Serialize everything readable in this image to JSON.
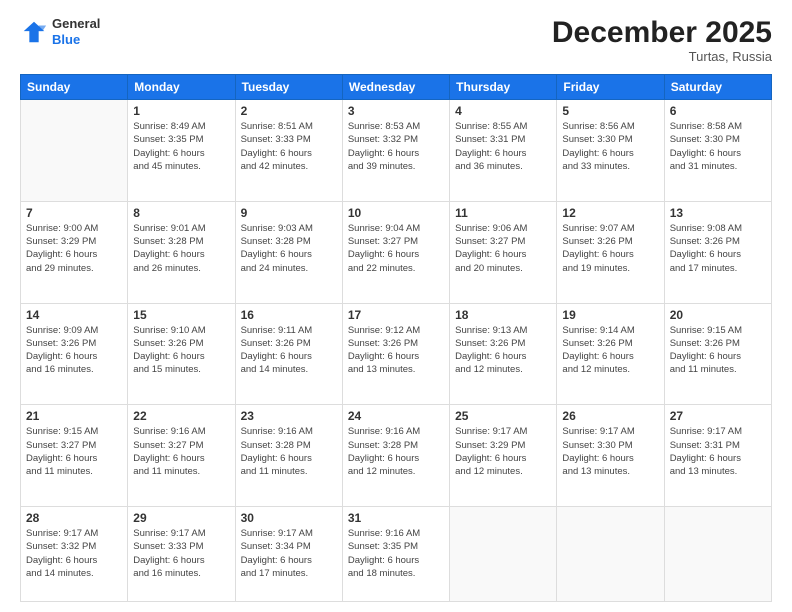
{
  "header": {
    "logo_line1": "General",
    "logo_line2": "Blue",
    "month": "December 2025",
    "location": "Turtas, Russia"
  },
  "weekdays": [
    "Sunday",
    "Monday",
    "Tuesday",
    "Wednesday",
    "Thursday",
    "Friday",
    "Saturday"
  ],
  "weeks": [
    [
      {
        "day": "",
        "info": ""
      },
      {
        "day": "1",
        "info": "Sunrise: 8:49 AM\nSunset: 3:35 PM\nDaylight: 6 hours\nand 45 minutes."
      },
      {
        "day": "2",
        "info": "Sunrise: 8:51 AM\nSunset: 3:33 PM\nDaylight: 6 hours\nand 42 minutes."
      },
      {
        "day": "3",
        "info": "Sunrise: 8:53 AM\nSunset: 3:32 PM\nDaylight: 6 hours\nand 39 minutes."
      },
      {
        "day": "4",
        "info": "Sunrise: 8:55 AM\nSunset: 3:31 PM\nDaylight: 6 hours\nand 36 minutes."
      },
      {
        "day": "5",
        "info": "Sunrise: 8:56 AM\nSunset: 3:30 PM\nDaylight: 6 hours\nand 33 minutes."
      },
      {
        "day": "6",
        "info": "Sunrise: 8:58 AM\nSunset: 3:30 PM\nDaylight: 6 hours\nand 31 minutes."
      }
    ],
    [
      {
        "day": "7",
        "info": ""
      },
      {
        "day": "8",
        "info": "Sunrise: 9:01 AM\nSunset: 3:28 PM\nDaylight: 6 hours\nand 26 minutes."
      },
      {
        "day": "9",
        "info": "Sunrise: 9:03 AM\nSunset: 3:28 PM\nDaylight: 6 hours\nand 24 minutes."
      },
      {
        "day": "10",
        "info": "Sunrise: 9:04 AM\nSunset: 3:27 PM\nDaylight: 6 hours\nand 22 minutes."
      },
      {
        "day": "11",
        "info": "Sunrise: 9:06 AM\nSunset: 3:27 PM\nDaylight: 6 hours\nand 20 minutes."
      },
      {
        "day": "12",
        "info": "Sunrise: 9:07 AM\nSunset: 3:26 PM\nDaylight: 6 hours\nand 19 minutes."
      },
      {
        "day": "13",
        "info": "Sunrise: 9:08 AM\nSunset: 3:26 PM\nDaylight: 6 hours\nand 17 minutes."
      }
    ],
    [
      {
        "day": "14",
        "info": ""
      },
      {
        "day": "15",
        "info": "Sunrise: 9:10 AM\nSunset: 3:26 PM\nDaylight: 6 hours\nand 15 minutes."
      },
      {
        "day": "16",
        "info": "Sunrise: 9:11 AM\nSunset: 3:26 PM\nDaylight: 6 hours\nand 14 minutes."
      },
      {
        "day": "17",
        "info": "Sunrise: 9:12 AM\nSunset: 3:26 PM\nDaylight: 6 hours\nand 13 minutes."
      },
      {
        "day": "18",
        "info": "Sunrise: 9:13 AM\nSunset: 3:26 PM\nDaylight: 6 hours\nand 12 minutes."
      },
      {
        "day": "19",
        "info": "Sunrise: 9:14 AM\nSunset: 3:26 PM\nDaylight: 6 hours\nand 12 minutes."
      },
      {
        "day": "20",
        "info": "Sunrise: 9:15 AM\nSunset: 3:26 PM\nDaylight: 6 hours\nand 11 minutes."
      }
    ],
    [
      {
        "day": "21",
        "info": ""
      },
      {
        "day": "22",
        "info": "Sunrise: 9:16 AM\nSunset: 3:27 PM\nDaylight: 6 hours\nand 11 minutes."
      },
      {
        "day": "23",
        "info": "Sunrise: 9:16 AM\nSunset: 3:28 PM\nDaylight: 6 hours\nand 11 minutes."
      },
      {
        "day": "24",
        "info": "Sunrise: 9:16 AM\nSunset: 3:28 PM\nDaylight: 6 hours\nand 12 minutes."
      },
      {
        "day": "25",
        "info": "Sunrise: 9:17 AM\nSunset: 3:29 PM\nDaylight: 6 hours\nand 12 minutes."
      },
      {
        "day": "26",
        "info": "Sunrise: 9:17 AM\nSunset: 3:30 PM\nDaylight: 6 hours\nand 13 minutes."
      },
      {
        "day": "27",
        "info": "Sunrise: 9:17 AM\nSunset: 3:31 PM\nDaylight: 6 hours\nand 13 minutes."
      }
    ],
    [
      {
        "day": "28",
        "info": "Sunrise: 9:17 AM\nSunset: 3:32 PM\nDaylight: 6 hours\nand 14 minutes."
      },
      {
        "day": "29",
        "info": "Sunrise: 9:17 AM\nSunset: 3:33 PM\nDaylight: 6 hours\nand 16 minutes."
      },
      {
        "day": "30",
        "info": "Sunrise: 9:17 AM\nSunset: 3:34 PM\nDaylight: 6 hours\nand 17 minutes."
      },
      {
        "day": "31",
        "info": "Sunrise: 9:16 AM\nSunset: 3:35 PM\nDaylight: 6 hours\nand 18 minutes."
      },
      {
        "day": "",
        "info": ""
      },
      {
        "day": "",
        "info": ""
      },
      {
        "day": "",
        "info": ""
      }
    ]
  ],
  "week1_day7_info": "Sunrise: 9:00 AM\nSunset: 3:29 PM\nDaylight: 6 hours\nand 29 minutes.",
  "week2_day14_info": "Sunrise: 9:09 AM\nSunset: 3:26 PM\nDaylight: 6 hours\nand 16 minutes.",
  "week3_day21_info": "Sunrise: 9:15 AM\nSunset: 3:27 PM\nDaylight: 6 hours\nand 11 minutes."
}
